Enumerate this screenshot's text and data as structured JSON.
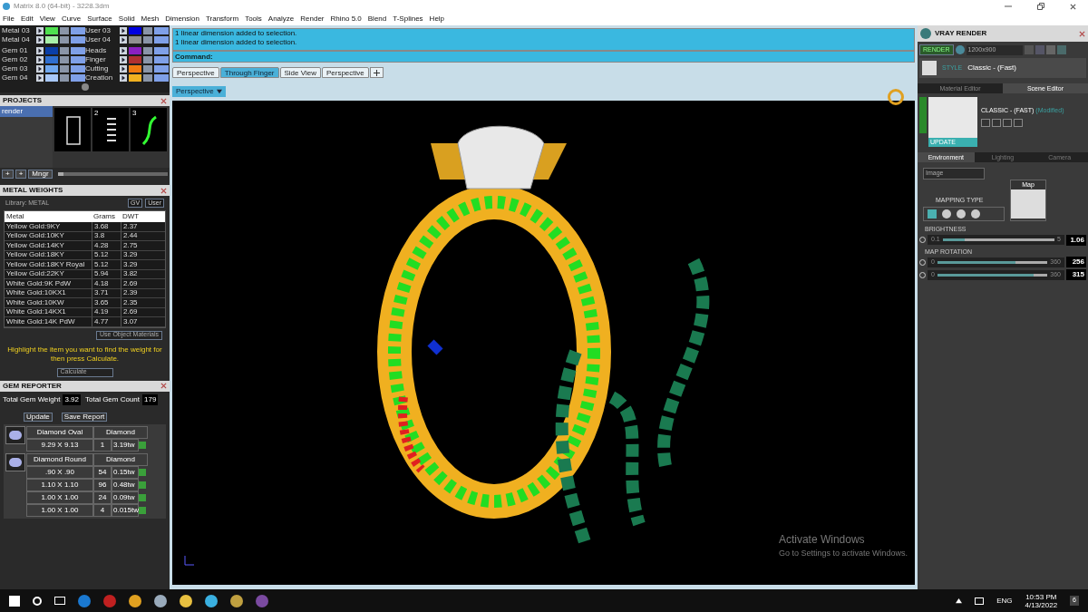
{
  "window": {
    "title": "Matrix 8.0 (64-bit) - 3228.3dm"
  },
  "menu": [
    "File",
    "Edit",
    "View",
    "Curve",
    "Surface",
    "Solid",
    "Mesh",
    "Dimension",
    "Transform",
    "Tools",
    "Analyze",
    "Render",
    "Rhino 5.0",
    "Blend",
    "T-Splines",
    "Help"
  ],
  "layers": {
    "left": [
      {
        "name": "Metal 03",
        "color": "#4fe04f",
        "on": true
      },
      {
        "name": "Metal 04",
        "color": "#a8f0a8",
        "on": true
      },
      {
        "name": "Gem 01",
        "color": "#0a3fa8",
        "on": true
      },
      {
        "name": "Gem 02",
        "color": "#2f6fd0",
        "on": true
      },
      {
        "name": "Gem 03",
        "color": "#6fa8f0",
        "on": true
      },
      {
        "name": "Gem 04",
        "color": "#a8c8f8",
        "on": true
      }
    ],
    "right": [
      {
        "name": "User 03",
        "color": "#0000e0",
        "on": true
      },
      {
        "name": "User 04",
        "color": "#909090",
        "on": true
      },
      {
        "name": "Heads",
        "color": "#8a20c0",
        "on": true
      },
      {
        "name": "Finger",
        "color": "#b03030",
        "on": true
      },
      {
        "name": "Cutting",
        "color": "#f07a10",
        "on": true
      },
      {
        "name": "Creation",
        "color": "#f0b020",
        "on": true
      }
    ]
  },
  "projects": {
    "title": "PROJECTS",
    "items": [
      {
        "label": "render",
        "selected": true
      }
    ],
    "thumbnails": [
      {
        "kind": "frame"
      },
      {
        "kind": "list",
        "label": "2"
      },
      {
        "kind": "curve",
        "label": "3"
      }
    ],
    "buttons": [
      "+",
      "+",
      "Mngr"
    ],
    "zoom": {
      "level": 0.05
    }
  },
  "metal_weights": {
    "title": "METAL WEIGHTS",
    "library": "Library: METAL",
    "toggles": [
      "GV",
      "User"
    ],
    "columns": [
      "Metal",
      "Grams",
      "DWT"
    ],
    "rows": [
      [
        "Yellow Gold:9KY",
        "3.68",
        "2.37"
      ],
      [
        "Yellow Gold:10KY",
        "3.8",
        "2.44"
      ],
      [
        "Yellow Gold:14KY",
        "4.28",
        "2.75"
      ],
      [
        "Yellow Gold:18KY",
        "5.12",
        "3.29"
      ],
      [
        "Yellow Gold:18KY Royal",
        "5.12",
        "3.29"
      ],
      [
        "Yellow Gold:22KY",
        "5.94",
        "3.82"
      ],
      [
        "White Gold:9K PdW",
        "4.18",
        "2.69"
      ],
      [
        "White Gold:10KX1",
        "3.71",
        "2.39"
      ],
      [
        "White Gold:10KW",
        "3.65",
        "2.35"
      ],
      [
        "White Gold:14KX1",
        "4.19",
        "2.69"
      ],
      [
        "White Gold:14K PdW",
        "4.77",
        "3.07"
      ]
    ],
    "use_object_materials": "Use Object Materials",
    "hint": "Highlight the item you want to find the weight for then press Calculate.",
    "calculate": "Calculate"
  },
  "gem_reporter": {
    "title": "GEM REPORTER",
    "total_weight_label": "Total Gem Weight",
    "total_weight": "3.92",
    "total_count_label": "Total Gem Count",
    "total_count": "179",
    "update": "Update",
    "save_report": "Save Report",
    "groups": [
      {
        "shape": "Diamond Oval",
        "type": "Diamond",
        "rows": [
          [
            "9.29 X 9.13",
            "1",
            "3.19tw"
          ]
        ]
      },
      {
        "shape": "Diamond Round",
        "type": "Diamond",
        "rows": [
          [
            ".90 X .90",
            "54",
            "0.15tw"
          ],
          [
            "1.10 X 1.10",
            "96",
            "0.48tw"
          ],
          [
            "1.00 X 1.00",
            "24",
            "0.09tw"
          ],
          [
            "1.00 X 1.00",
            "4",
            "0.015tw"
          ]
        ]
      }
    ]
  },
  "messages": [
    "1 linear dimension added to selection.",
    "1 linear dimension added to selection."
  ],
  "command_label": "Command:",
  "view_tabs": [
    {
      "label": "Perspective",
      "selected": false
    },
    {
      "label": "Through Finger",
      "selected": true
    },
    {
      "label": "Side View",
      "selected": false
    },
    {
      "label": "Perspective",
      "selected": false
    }
  ],
  "viewport": {
    "label": "Perspective",
    "watermark_title": "Activate Windows",
    "watermark_text": "Go to Settings to activate Windows."
  },
  "vray": {
    "title": "VRAY RENDER",
    "render": "RENDER",
    "resolution": "1200x900",
    "style_label": "STYLE",
    "style": "Classic - (Fast)",
    "editor_tabs": [
      {
        "label": "Material Editor",
        "selected": false
      },
      {
        "label": "Scene Editor",
        "selected": true
      }
    ],
    "preset": "CLASSIC - (FAST)",
    "modified": "(Modified)",
    "update": "UPDATE",
    "env_tabs": [
      {
        "label": "Environment",
        "selected": true
      },
      {
        "label": "Lighting",
        "selected": false
      },
      {
        "label": "Camera",
        "selected": false
      }
    ],
    "env_type": "Image",
    "mapping_type": "MAPPING TYPE",
    "map_label": "Map",
    "sliders": [
      {
        "heading": "BRIGHTNESS",
        "min": "0.1",
        "max": "5",
        "reading": "1.06",
        "level": 0.2
      },
      {
        "heading": "MAP ROTATION",
        "min": "0",
        "max": "360",
        "reading": "256",
        "level": 0.71
      },
      {
        "min": "0",
        "max": "360",
        "reading": "315",
        "level": 0.875
      }
    ]
  },
  "taskbar": {
    "language": "ENG",
    "time": "10:53 PM",
    "date": "4/13/2022",
    "notifications": "6"
  }
}
